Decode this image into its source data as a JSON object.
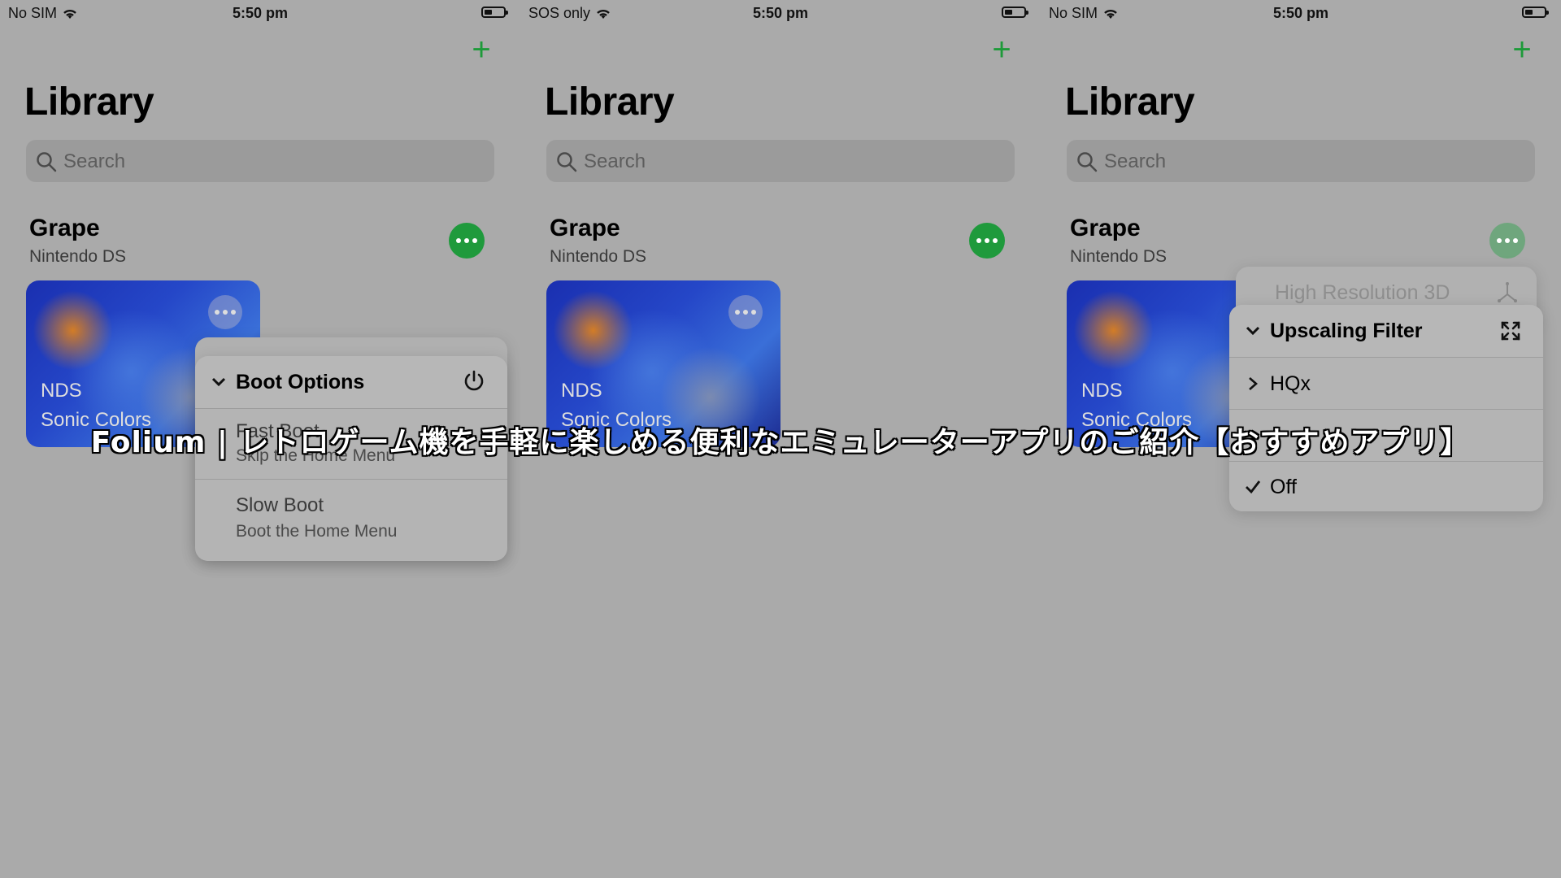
{
  "panels": [
    {
      "carrier": "No SIM",
      "time": "5:50 pm"
    },
    {
      "carrier": "SOS only",
      "time": "5:50 pm"
    },
    {
      "carrier": "No SIM",
      "time": "5:50 pm"
    }
  ],
  "library": {
    "title": "Library",
    "search_placeholder": "Search",
    "add_label": "+",
    "section_title": "Grape",
    "section_subtitle": "Nintendo DS",
    "game": {
      "platform": "NDS",
      "name": "Sonic Colors"
    }
  },
  "boot_menu": {
    "header": "Boot Options",
    "ghost_label": "Fast Boot",
    "items": [
      {
        "title": "Fast Boot",
        "subtitle": "Skip the Home Menu"
      },
      {
        "title": "Slow Boot",
        "subtitle": "Boot the Home Menu"
      }
    ]
  },
  "upscale_menu": {
    "ghost_label": "High Resolution 3D",
    "header": "Upscaling Filter",
    "items": [
      {
        "label": "HQx",
        "kind": "submenu"
      },
      {
        "label": "",
        "kind": "submenu"
      },
      {
        "label": "Off",
        "kind": "checked"
      }
    ]
  },
  "banner": "Folium | レトロゲーム機を手軽に楽しめる便利なエミュレーターアプリのご紹介【おすすめアプリ】",
  "colors": {
    "accent": "#1f9a3c",
    "background": "#aaaaaa"
  }
}
